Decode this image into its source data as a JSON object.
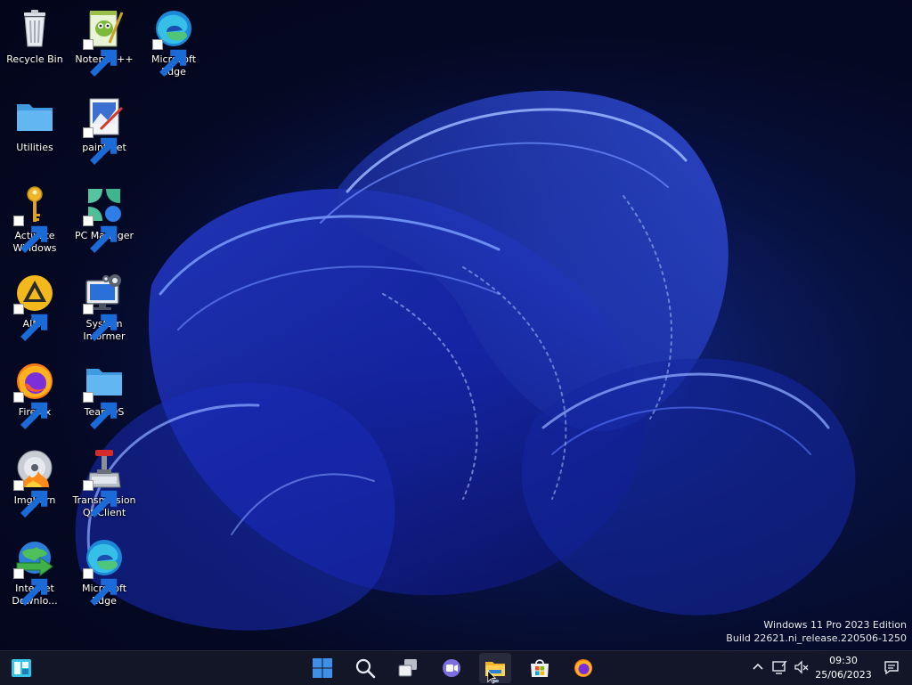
{
  "desktop": {
    "icons": [
      {
        "name": "recycle-bin",
        "label": [
          "Recycle Bin"
        ],
        "shortcut": false
      },
      {
        "name": "notepad-plus-plus",
        "label": [
          "Notepad++"
        ],
        "shortcut": true
      },
      {
        "name": "microsoft-edge",
        "label": [
          "Microsoft",
          "Edge"
        ],
        "shortcut": true
      },
      {
        "name": "utilities-folder",
        "label": [
          "Utilities"
        ],
        "shortcut": false
      },
      {
        "name": "paint-net",
        "label": [
          "paint.net"
        ],
        "shortcut": true
      },
      {
        "name": "activate-windows",
        "label": [
          "Activate",
          "Windows"
        ],
        "shortcut": true
      },
      {
        "name": "pc-manager",
        "label": [
          "PC Manager"
        ],
        "shortcut": true
      },
      {
        "name": "aimp",
        "label": [
          "AIMP"
        ],
        "shortcut": true
      },
      {
        "name": "system-informer",
        "label": [
          "System",
          "Informer"
        ],
        "shortcut": true
      },
      {
        "name": "firefox",
        "label": [
          "Firefox"
        ],
        "shortcut": true
      },
      {
        "name": "teamos-folder",
        "label": [
          "TeamOS"
        ],
        "shortcut": true
      },
      {
        "name": "imgburn",
        "label": [
          "ImgBurn"
        ],
        "shortcut": true
      },
      {
        "name": "transmission",
        "label": [
          "Transmission",
          "Qt Client"
        ],
        "shortcut": true
      },
      {
        "name": "internet-download-manager",
        "label": [
          "Internet",
          "Downlo..."
        ],
        "shortcut": true
      },
      {
        "name": "microsoft-edge-2",
        "label": [
          "Microsoft",
          "Edge"
        ],
        "shortcut": true
      }
    ]
  },
  "watermark": {
    "line1": "Windows 11 Pro 2023 Edition",
    "line2": "Build 22621.ni_release.220506-1250"
  },
  "taskbar": {
    "widgets_icon": "widgets-icon",
    "start_icon": "windows-start-icon",
    "search_icon": "search-icon",
    "task_view_icon": "task-view-icon",
    "chat_icon": "teams-chat-icon",
    "explorer_icon": "file-explorer-icon",
    "store_icon": "microsoft-store-icon",
    "firefox_icon": "firefox-icon",
    "tray": {
      "chevron": "chevron-up-icon",
      "network": "network-icon",
      "volume": "volume-muted-icon",
      "notifications": "notifications-icon"
    },
    "clock": {
      "time": "09:30",
      "date": "25/06/2023"
    }
  },
  "colors": {
    "accent": "#2f6bff",
    "taskbar_bg": "#14182a",
    "folder": "#58b4f0"
  }
}
